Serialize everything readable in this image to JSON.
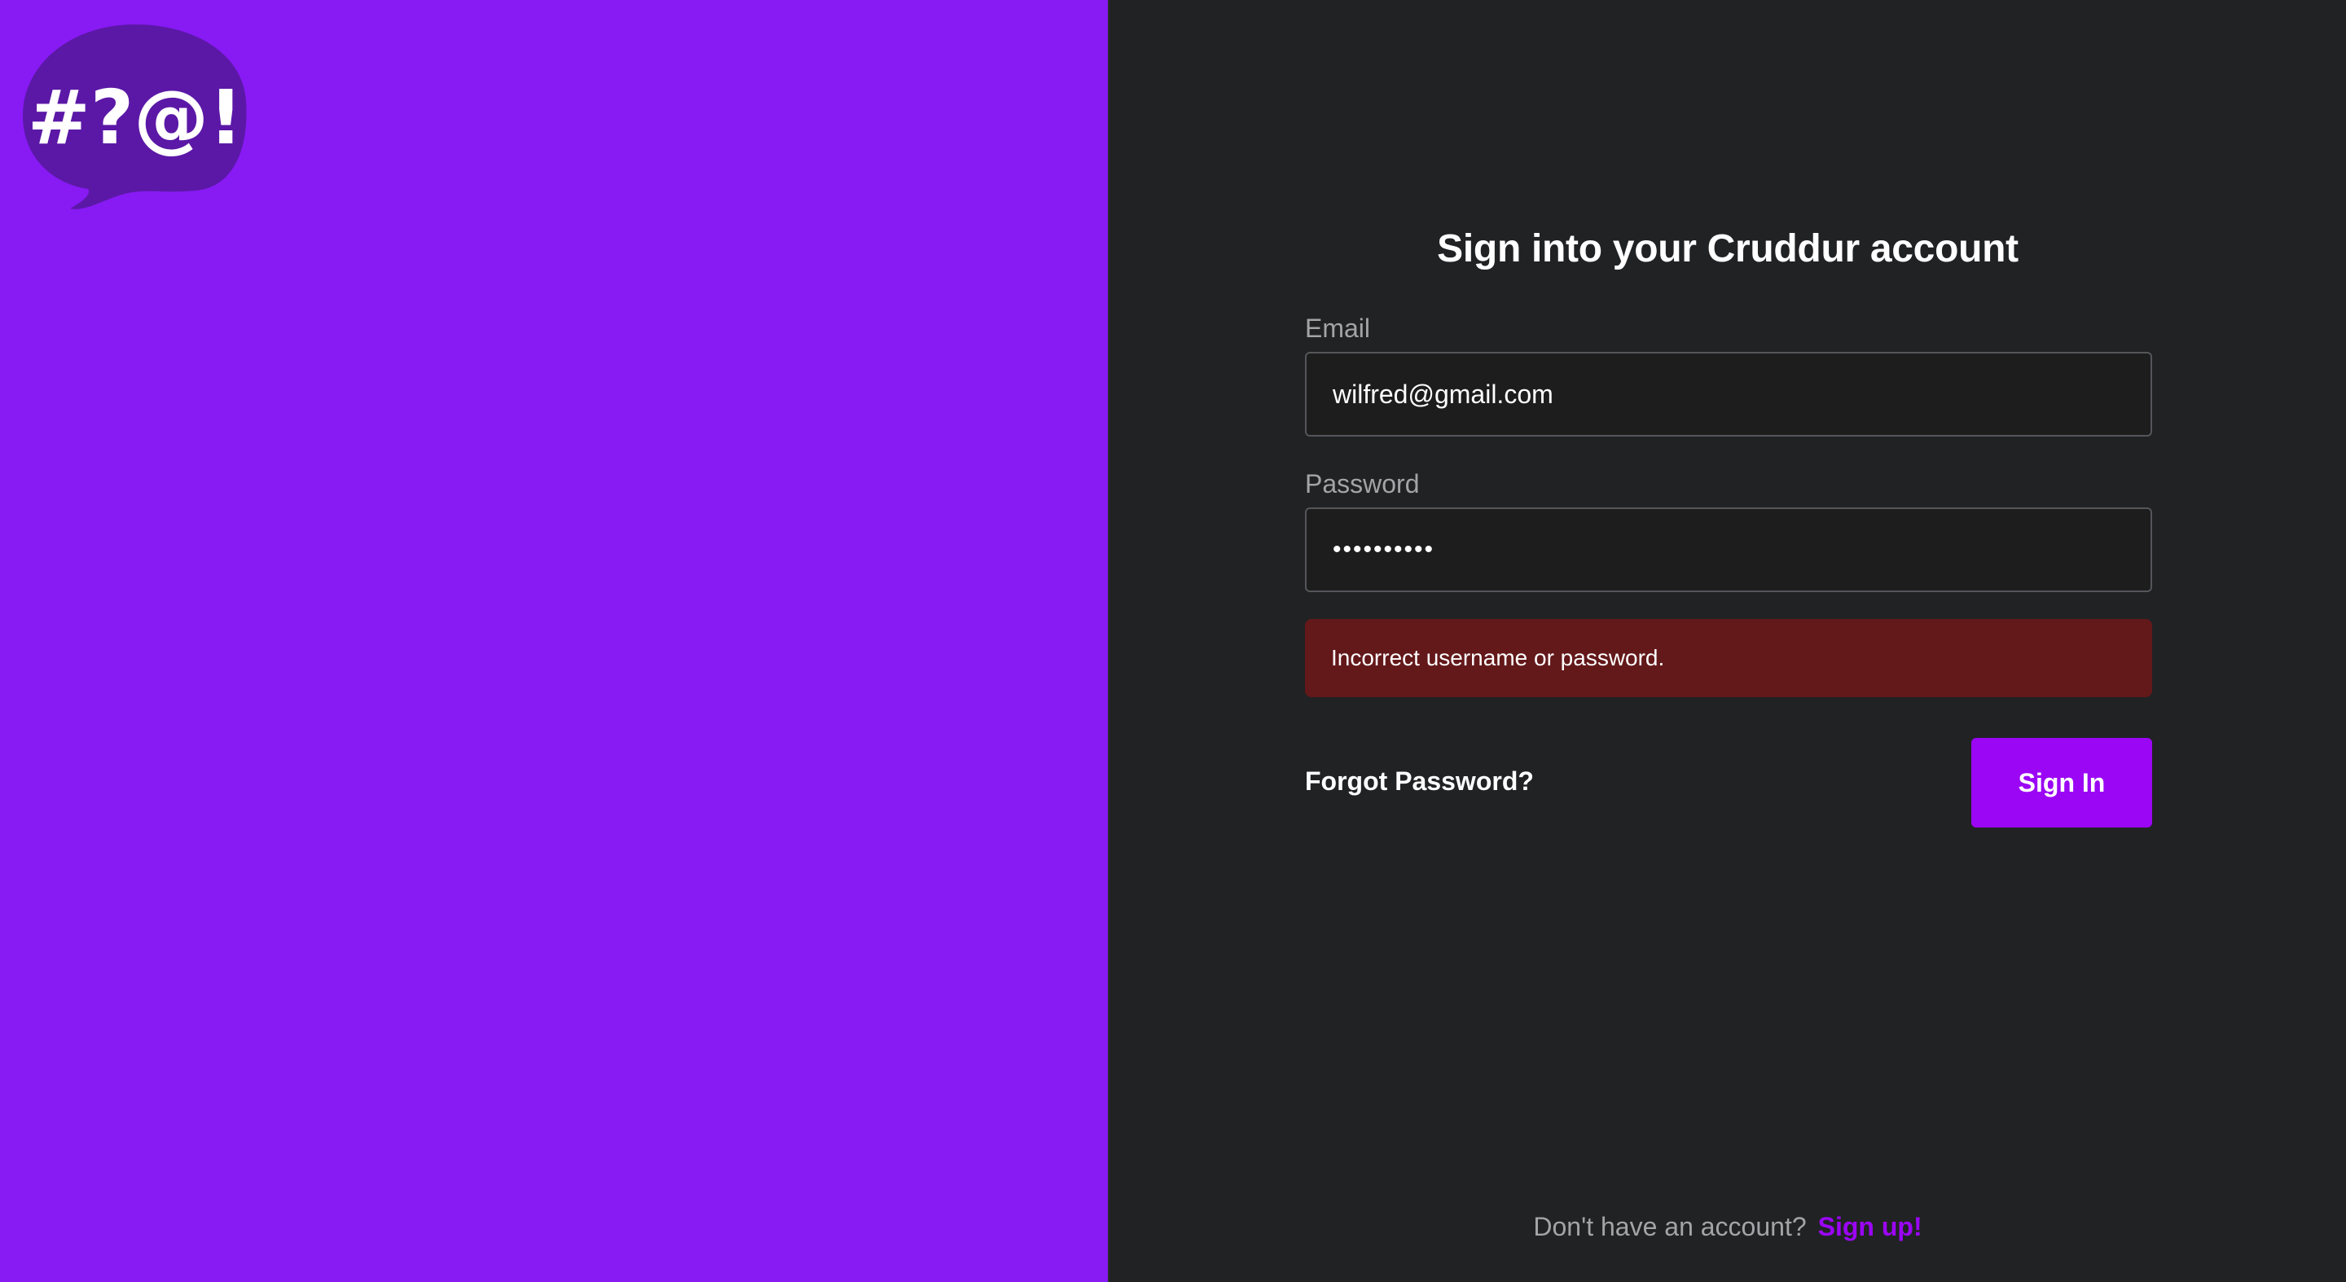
{
  "brand": {
    "logo_icon": "speech-bubble-symbols-logo",
    "logo_text": "#?@!",
    "panel_color": "#881af4"
  },
  "form": {
    "title": "Sign into your Cruddur account",
    "email_label": "Email",
    "email_value": "wilfred@gmail.com",
    "password_label": "Password",
    "password_value": "••••••••••",
    "error_message": "Incorrect username or password.",
    "forgot_password_label": "Forgot Password?",
    "sign_in_label": "Sign In"
  },
  "footer": {
    "prompt": "Don't have an account?",
    "signup_label": "Sign up!"
  },
  "colors": {
    "accent": "#9b06f5",
    "background": "#212224",
    "error_bg": "#63181a"
  }
}
